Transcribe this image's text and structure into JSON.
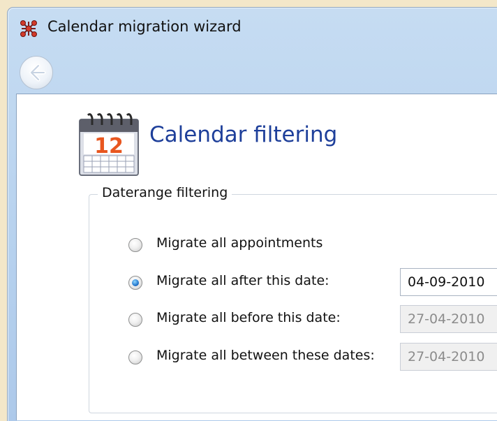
{
  "window": {
    "title": "Calendar migration wizard",
    "app_icon": "network-nodes-icon",
    "back_icon": "back-arrow-icon"
  },
  "page": {
    "heading": "Calendar filtering",
    "heading_icon": "calendar-icon",
    "calendar_day": "12"
  },
  "daterange": {
    "legend": "Daterange filtering",
    "options": [
      {
        "label": "Migrate all appointments",
        "checked": false
      },
      {
        "label": "Migrate all after this date:",
        "checked": true,
        "date": "04-09-2010",
        "enabled": true
      },
      {
        "label": "Migrate all before this date:",
        "checked": false,
        "date": "27-04-2010",
        "enabled": false
      },
      {
        "label": "Migrate all between these dates:",
        "checked": false,
        "date": "27-04-2010",
        "enabled": false
      }
    ]
  },
  "colors": {
    "heading": "#1e3f9a",
    "chrome": "#b6d1ee",
    "selected_radio": "#2b7fd2"
  }
}
